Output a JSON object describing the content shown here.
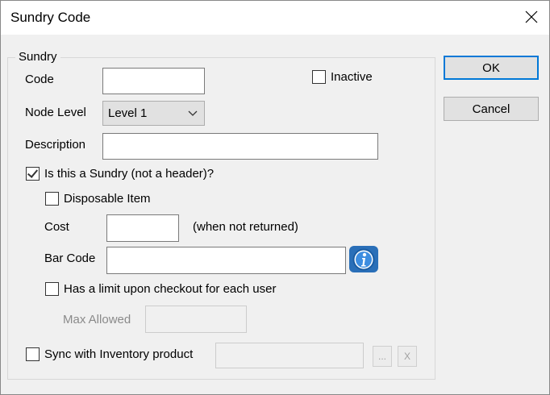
{
  "window": {
    "title": "Sundry Code"
  },
  "group": {
    "legend": "Sundry"
  },
  "fields": {
    "code": {
      "label": "Code",
      "value": ""
    },
    "inactive": {
      "label": "Inactive",
      "checked": false
    },
    "node_level": {
      "label": "Node Level",
      "selected": "Level 1"
    },
    "description": {
      "label": "Description",
      "value": ""
    },
    "is_sundry": {
      "label": "Is this a Sundry (not a header)?",
      "checked": true
    },
    "disposable": {
      "label": "Disposable Item",
      "checked": false
    },
    "cost": {
      "label": "Cost",
      "value": "",
      "hint": "(when not returned)"
    },
    "bar_code": {
      "label": "Bar Code",
      "value": ""
    },
    "has_limit": {
      "label": "Has a limit upon checkout for each user",
      "checked": false
    },
    "max_allowed": {
      "label": "Max Allowed",
      "value": ""
    },
    "sync_inventory": {
      "label": "Sync with Inventory product",
      "checked": false,
      "value": ""
    }
  },
  "buttons": {
    "ok": "OK",
    "cancel": "Cancel",
    "browse": "...",
    "clear": "X"
  },
  "icons": {
    "close": "close-icon",
    "dropdown": "chevron-down-icon",
    "info": "info-icon"
  },
  "colors": {
    "accent": "#0078d7",
    "info_button": "#2a6fb8",
    "disabled_text": "#8a8a8a"
  }
}
